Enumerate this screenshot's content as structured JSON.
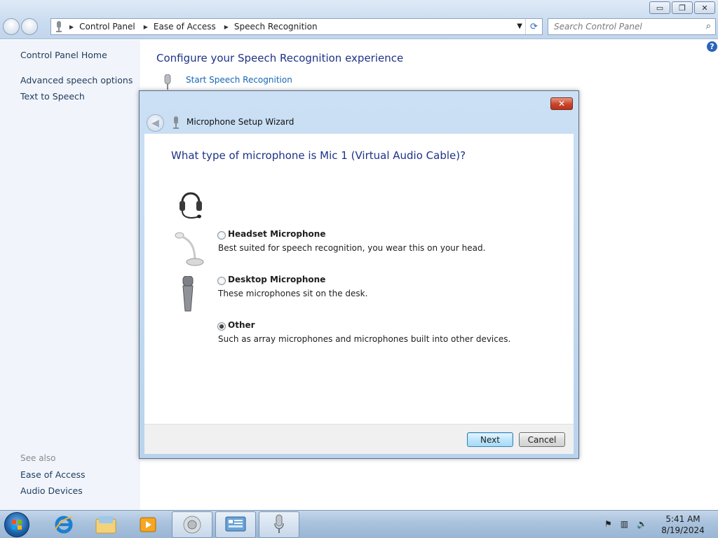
{
  "window": {
    "minimize_glyph": "▭",
    "restore_glyph": "❐",
    "close_glyph": "✕"
  },
  "breadcrumb": {
    "items": [
      "Control Panel",
      "Ease of Access",
      "Speech Recognition"
    ]
  },
  "search": {
    "placeholder": "Search Control Panel"
  },
  "left_pane": {
    "home": "Control Panel Home",
    "links": [
      "Advanced speech options",
      "Text to Speech"
    ],
    "see_also_label": "See also",
    "see_also": [
      "Ease of Access",
      "Audio Devices"
    ]
  },
  "main": {
    "title": "Configure your Speech Recognition experience",
    "start_link": "Start Speech Recognition"
  },
  "dialog": {
    "title": "Microphone Setup Wizard",
    "question": "What type of microphone is Mic 1 (Virtual Audio Cable)?",
    "options": [
      {
        "label": "Headset Microphone",
        "desc": "Best suited for speech recognition, you wear this on your head.",
        "selected": false
      },
      {
        "label": "Desktop Microphone",
        "desc": "These microphones sit on the desk.",
        "selected": false
      },
      {
        "label": "Other",
        "desc": "Such as array microphones and microphones built into other devices.",
        "selected": true
      }
    ],
    "next_label": "Next",
    "cancel_label": "Cancel"
  },
  "taskbar": {
    "time": "5:41 AM",
    "date": "8/19/2024",
    "items": [
      "start-orb",
      "internet-explorer",
      "windows-explorer",
      "media-player",
      "speaker-properties",
      "control-panel",
      "speech-recognition"
    ]
  },
  "colors": {
    "title_blue": "#1e3287",
    "link_blue": "#1466b3",
    "left_pane_bg": "#f1f5fb"
  }
}
